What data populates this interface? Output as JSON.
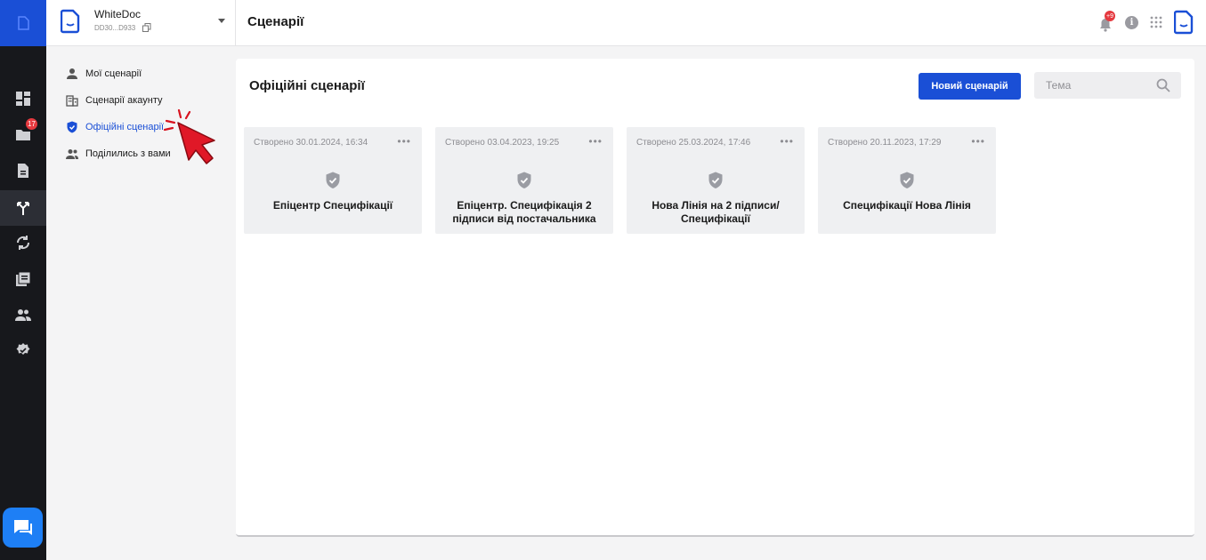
{
  "workspace": {
    "name": "WhiteDoc",
    "id": "DD30...D933"
  },
  "rail": {
    "folder_badge": "17"
  },
  "topbar": {
    "title": "Сценарії",
    "notifications_badge": "+9"
  },
  "sidenav": {
    "items": [
      {
        "label": "Мої сценарії",
        "icon": "person-icon",
        "active": false
      },
      {
        "label": "Сценарії акаунту",
        "icon": "building-icon",
        "active": false
      },
      {
        "label": "Офіційні сценарії",
        "icon": "shield-icon",
        "active": true
      },
      {
        "label": "Поділились з вами",
        "icon": "people-icon",
        "active": false
      }
    ]
  },
  "panel": {
    "title": "Офіційні сценарії",
    "new_button": "Новий сценарій",
    "search_placeholder": "Тема"
  },
  "cards": [
    {
      "date": "Створено 30.01.2024, 16:34",
      "title": "Епіцентр Специфікації"
    },
    {
      "date": "Створено 03.04.2023, 19:25",
      "title": "Епіцентр. Специфікація 2 підписи від постачальника"
    },
    {
      "date": "Створено 25.03.2024, 17:46",
      "title": "Нова Лінія на 2 підписи/ Специфікації"
    },
    {
      "date": "Створено 20.11.2023, 17:29",
      "title": "Специфікації Нова Лінія"
    }
  ],
  "colors": {
    "accent": "#1a4fd6",
    "rail_bg": "#17181c",
    "badge": "#e5393f",
    "chat": "#1e7ff5"
  }
}
